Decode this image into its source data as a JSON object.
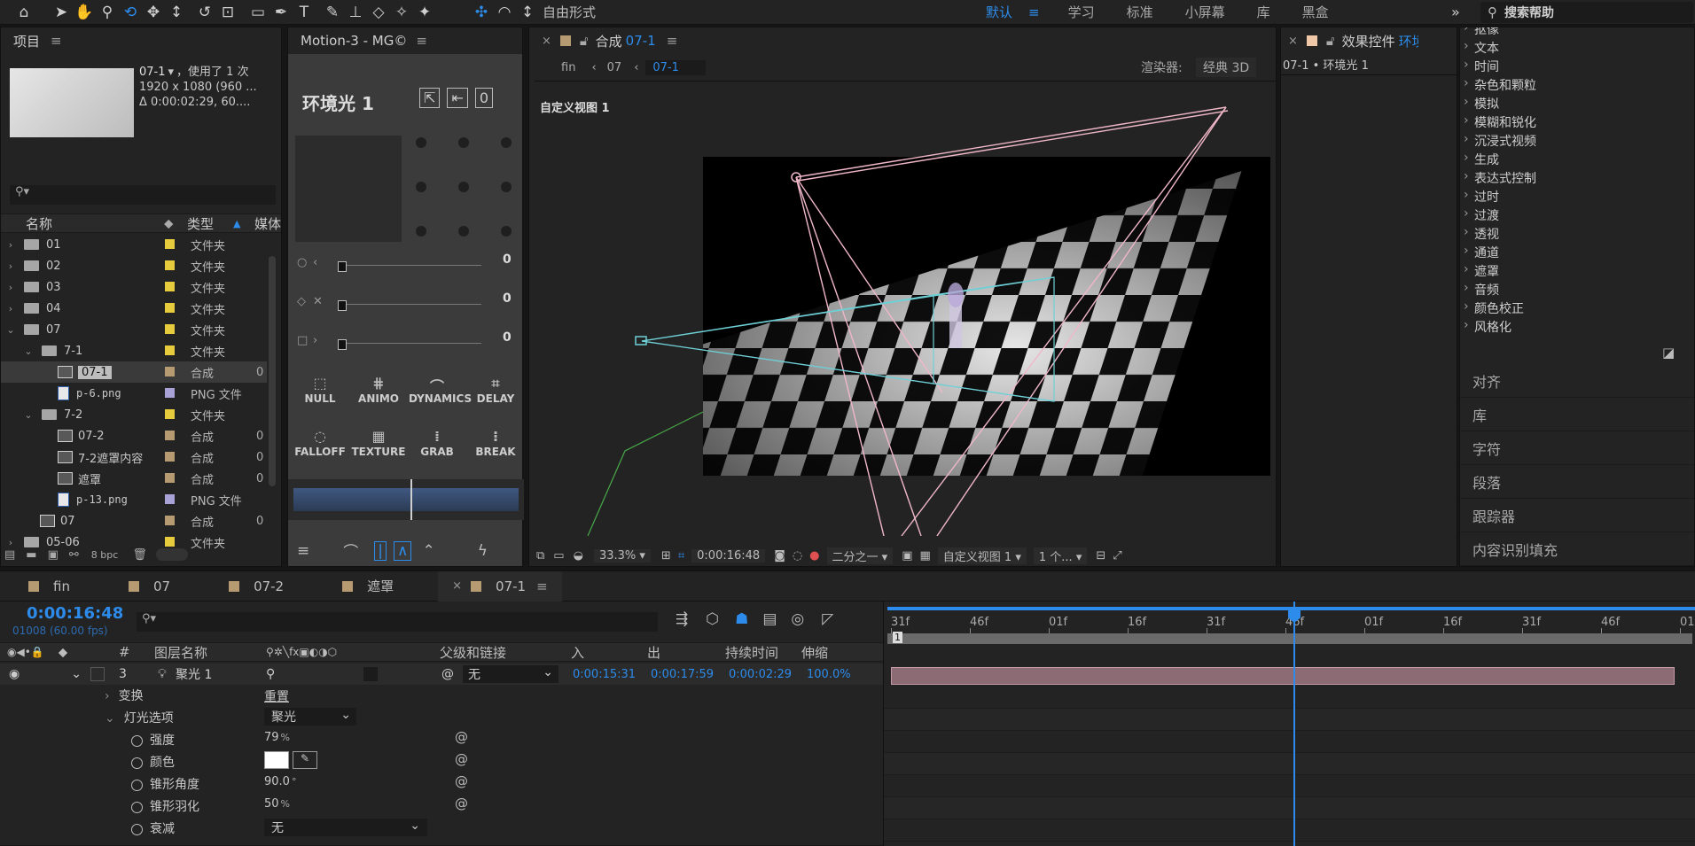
{
  "toolbar": {
    "mode": "自由形式",
    "workspaces": [
      "默认",
      "学习",
      "标准",
      "小屏幕",
      "库",
      "黑盒"
    ],
    "more": "»",
    "search_placeholder": "搜索帮助"
  },
  "project": {
    "tab": "项目",
    "comp_name": "07-1",
    "comp_used": "，使用了 1 次",
    "comp_res": "1920 x 1080 (960 ...",
    "comp_dur": "Δ 0:00:02:29, 60....",
    "col_name": "名称",
    "col_type": "类型",
    "col_media": "媒体",
    "bpc": "8 bpc",
    "rows": [
      {
        "name": "01",
        "type": "文件夹",
        "kind": "folder",
        "depth": 0,
        "open": false,
        "color": "#e6cb3d",
        "num": ""
      },
      {
        "name": "02",
        "type": "文件夹",
        "kind": "folder",
        "depth": 0,
        "open": false,
        "color": "#e6cb3d",
        "num": ""
      },
      {
        "name": "03",
        "type": "文件夹",
        "kind": "folder",
        "depth": 0,
        "open": false,
        "color": "#e6cb3d",
        "num": ""
      },
      {
        "name": "04",
        "type": "文件夹",
        "kind": "folder",
        "depth": 0,
        "open": false,
        "color": "#e6cb3d",
        "num": ""
      },
      {
        "name": "07",
        "type": "文件夹",
        "kind": "folder",
        "depth": 0,
        "open": true,
        "color": "#e6cb3d",
        "num": ""
      },
      {
        "name": "7-1",
        "type": "文件夹",
        "kind": "folder",
        "depth": 1,
        "open": true,
        "color": "#e6cb3d",
        "num": ""
      },
      {
        "name": "07-1",
        "type": "合成",
        "kind": "comp",
        "depth": 2,
        "open": null,
        "color": "#b69b72",
        "num": "0",
        "selected": true
      },
      {
        "name": "p-6.png",
        "type": "PNG 文件",
        "kind": "png",
        "depth": 2,
        "open": null,
        "color": "#a8a2d6",
        "num": ""
      },
      {
        "name": "7-2",
        "type": "文件夹",
        "kind": "folder",
        "depth": 1,
        "open": true,
        "color": "#e6cb3d",
        "num": ""
      },
      {
        "name": "07-2",
        "type": "合成",
        "kind": "comp",
        "depth": 2,
        "open": null,
        "color": "#b69b72",
        "num": "0"
      },
      {
        "name": "7-2遮罩内容",
        "type": "合成",
        "kind": "comp",
        "depth": 2,
        "open": null,
        "color": "#b69b72",
        "num": "0"
      },
      {
        "name": "遮罩",
        "type": "合成",
        "kind": "comp",
        "depth": 2,
        "open": null,
        "color": "#b69b72",
        "num": "0"
      },
      {
        "name": "p-13.png",
        "type": "PNG 文件",
        "kind": "png",
        "depth": 2,
        "open": null,
        "color": "#a8a2d6",
        "num": ""
      },
      {
        "name": "07",
        "type": "合成",
        "kind": "comp",
        "depth": 1,
        "open": null,
        "color": "#b69b72",
        "num": "0"
      },
      {
        "name": "05-06",
        "type": "文件夹",
        "kind": "folder",
        "depth": 0,
        "open": false,
        "color": "#e6cb3d",
        "num": ""
      }
    ]
  },
  "motion": {
    "tab": "Motion-3 - MG©",
    "title": "环境光 1",
    "slider_val": "0",
    "buttons1": [
      "NULL",
      "ANIMO",
      "DYNAMICS",
      "DELAY"
    ],
    "buttons2": [
      "FALLOFF",
      "TEXTURE",
      "GRAB",
      "BREAK"
    ]
  },
  "viewer": {
    "tab_label": "合成",
    "tab_comp": "07-1",
    "crumbs": [
      "fin",
      "07",
      "07-1"
    ],
    "renderer_label": "渲染器:",
    "renderer_value": "经典 3D",
    "view_label": "自定义视图 1",
    "zoom": "33.3%",
    "time": "0:00:16:48",
    "resolution": "二分之一",
    "view_select": "自定义视图 1",
    "view_count": "1 个..."
  },
  "effects": {
    "tab": "效果控件",
    "tab_layer": "环境",
    "path": "07-1 • 环境光 1"
  },
  "right": {
    "categories": [
      "抠像",
      "文本",
      "时间",
      "杂色和颗粒",
      "模拟",
      "模糊和锐化",
      "沉浸式视频",
      "生成",
      "表达式控制",
      "过时",
      "过渡",
      "透视",
      "通道",
      "遮罩",
      "音频",
      "颜色校正",
      "风格化"
    ],
    "sections": [
      "对齐",
      "库",
      "字符",
      "段落",
      "跟踪器",
      "内容识别填充"
    ]
  },
  "timeline": {
    "tabs": [
      "fin",
      "07",
      "07-2",
      "遮罩",
      "07-1"
    ],
    "tab_colors": [
      "#b69b72",
      "#b69b72",
      "#b69b72",
      "#b69b72",
      "#b69b72"
    ],
    "time": "0:00:16:48",
    "frames": "01008 (60.00 fps)",
    "cols": {
      "num": "#",
      "name": "图层名称",
      "parent": "父级和链接",
      "in": "入",
      "out": "出",
      "dur": "持续时间",
      "stretch": "伸缩"
    },
    "layer": {
      "num": "3",
      "name": "聚光 1",
      "parent": "无",
      "in": "0:00:15:31",
      "out": "0:00:17:59",
      "dur": "0:00:02:29",
      "stretch": "100.0%",
      "color": "#e8b4c2"
    },
    "transform": "变换",
    "reset": "重置",
    "light_opts": "灯光选项",
    "light_type": "聚光",
    "props": [
      {
        "name": "强度",
        "value": "79",
        "unit": "%"
      },
      {
        "name": "颜色",
        "value": "",
        "unit": ""
      },
      {
        "name": "锥形角度",
        "value": "90.0",
        "unit": "°"
      },
      {
        "name": "锥形羽化",
        "value": "50",
        "unit": "%"
      },
      {
        "name": "衰减",
        "value": "无",
        "unit": ""
      }
    ],
    "ruler": [
      "31f",
      "46f",
      "01f",
      "16f",
      "31f",
      "46f",
      "01f",
      "16f",
      "31f",
      "46f",
      "01"
    ],
    "work_marker": "1"
  },
  "colors": {
    "accent": "#2d8ceb",
    "light_bar": "#8d6b74",
    "bg": "#232323"
  }
}
